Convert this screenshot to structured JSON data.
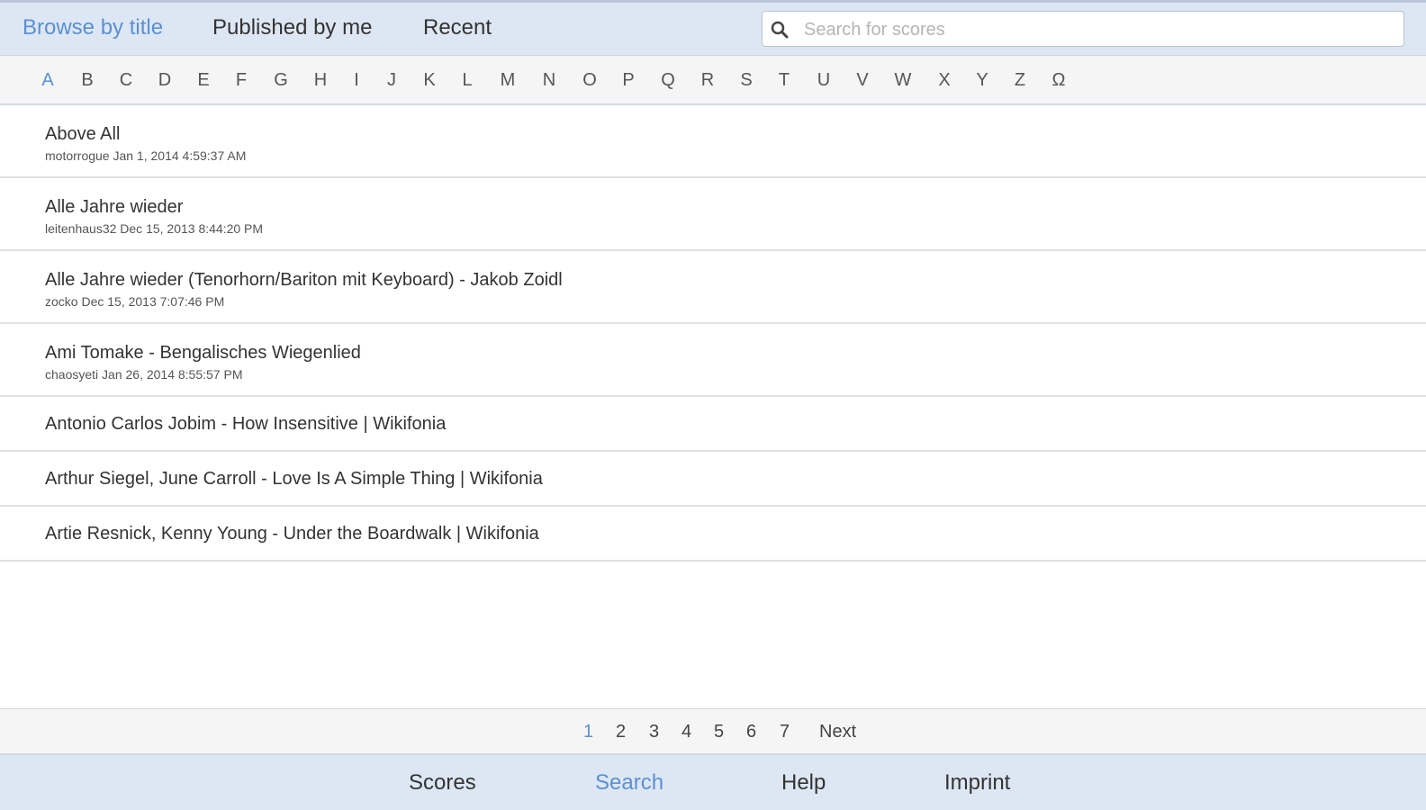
{
  "tabs": [
    {
      "label": "Browse by title",
      "active": true
    },
    {
      "label": "Published by me",
      "active": false
    },
    {
      "label": "Recent",
      "active": false
    }
  ],
  "search": {
    "placeholder": "Search for scores",
    "value": "",
    "icon": "search-icon"
  },
  "alphabet": {
    "letters": [
      "A",
      "B",
      "C",
      "D",
      "E",
      "F",
      "G",
      "H",
      "I",
      "J",
      "K",
      "L",
      "M",
      "N",
      "O",
      "P",
      "Q",
      "R",
      "S",
      "T",
      "U",
      "V",
      "W",
      "X",
      "Y",
      "Z",
      "Ω"
    ],
    "active": "A"
  },
  "scores": [
    {
      "title": "Above All",
      "meta": "motorrogue Jan 1, 2014 4:59:37 AM"
    },
    {
      "title": "Alle Jahre wieder",
      "meta": "leitenhaus32 Dec 15, 2013 8:44:20 PM"
    },
    {
      "title": "Alle Jahre wieder (Tenorhorn/Bariton mit Keyboard) - Jakob Zoidl",
      "meta": "zocko Dec 15, 2013 7:07:46 PM"
    },
    {
      "title": "Ami Tomake - Bengalisches Wiegenlied",
      "meta": "chaosyeti Jan 26, 2014 8:55:57 PM"
    },
    {
      "title": "Antonio Carlos Jobim - How Insensitive | Wikifonia",
      "meta": ""
    },
    {
      "title": "Arthur Siegel, June Carroll - Love Is A Simple Thing | Wikifonia",
      "meta": ""
    },
    {
      "title": "Artie Resnick, Kenny Young - Under the Boardwalk | Wikifonia",
      "meta": ""
    }
  ],
  "pagination": {
    "pages": [
      "1",
      "2",
      "3",
      "4",
      "5",
      "6",
      "7"
    ],
    "active": "1",
    "next_label": "Next"
  },
  "bottom_nav": [
    {
      "label": "Scores",
      "active": false
    },
    {
      "label": "Search",
      "active": true
    },
    {
      "label": "Help",
      "active": false
    },
    {
      "label": "Imprint",
      "active": false
    }
  ],
  "colors": {
    "accent": "#5b90d4",
    "header_bg": "#dde7f3",
    "bar_bg": "#f5f5f5"
  }
}
